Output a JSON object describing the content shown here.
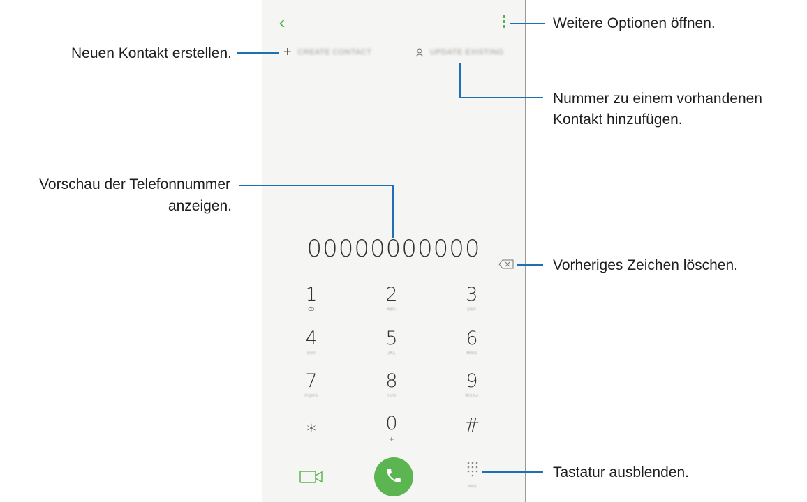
{
  "phone": {
    "back_icon": "chevron-left-icon",
    "more_icon": "more-vertical-icon",
    "actions": {
      "create_icon": "+",
      "create_label": "CREATE CONTACT",
      "update_label": "UPDATE EXISTING"
    },
    "number": "00000000000",
    "keypad": [
      {
        "digit": "1",
        "sub": "ꝏ"
      },
      {
        "digit": "2",
        "sub": "ABC"
      },
      {
        "digit": "3",
        "sub": "DEF"
      },
      {
        "digit": "4",
        "sub": "GHI"
      },
      {
        "digit": "5",
        "sub": "JKL"
      },
      {
        "digit": "6",
        "sub": "MNO"
      },
      {
        "digit": "7",
        "sub": "PQRS"
      },
      {
        "digit": "8",
        "sub": "TUV"
      },
      {
        "digit": "9",
        "sub": "WXYZ"
      },
      {
        "digit": "⁎",
        "sub": ""
      },
      {
        "digit": "0",
        "sub": "+"
      },
      {
        "digit": "#",
        "sub": ""
      }
    ],
    "hide_label": "HIDE",
    "accent_color": "#5bb550"
  },
  "annotations": {
    "more_options": "Weitere Optionen öffnen.",
    "create_contact": "Neuen Kontakt erstellen.",
    "add_to_existing_line1": "Nummer zu einem vorhandenen",
    "add_to_existing_line2": "Kontakt hinzufügen.",
    "preview_line1": "Vorschau der Telefonnummer",
    "preview_line2": "anzeigen.",
    "delete_char": "Vorheriges Zeichen löschen.",
    "hide_keypad": "Tastatur ausblenden."
  }
}
